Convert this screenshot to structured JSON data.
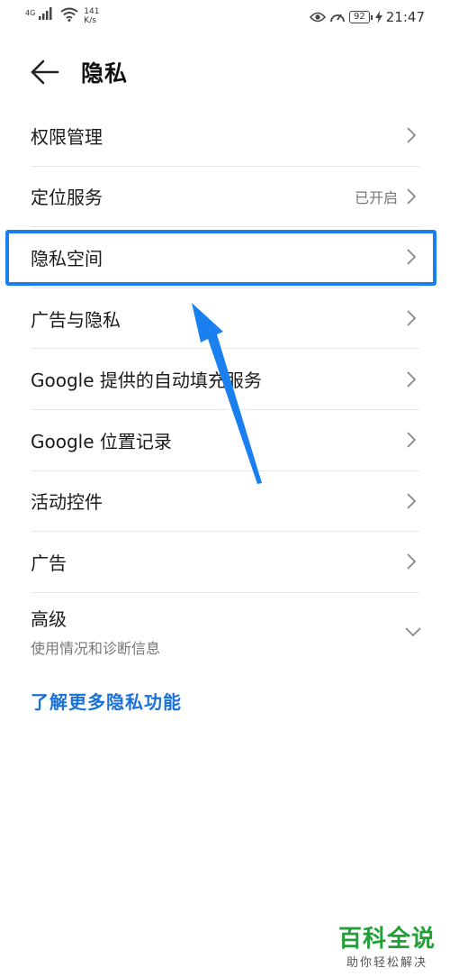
{
  "status_bar": {
    "signal_label": "4G",
    "speed_value": "141",
    "speed_unit": "K/s",
    "battery": "92",
    "time": "21:47"
  },
  "header": {
    "title": "隐私"
  },
  "list": {
    "items": [
      {
        "label": "权限管理",
        "value": ""
      },
      {
        "label": "定位服务",
        "value": "已开启"
      },
      {
        "label": "隐私空间",
        "value": ""
      },
      {
        "label": "广告与隐私",
        "value": ""
      },
      {
        "label": "Google 提供的自动填充服务",
        "value": ""
      },
      {
        "label": "Google 位置记录",
        "value": ""
      },
      {
        "label": "活动控件",
        "value": ""
      },
      {
        "label": "广告",
        "value": ""
      }
    ],
    "advanced": {
      "label": "高级",
      "subtitle": "使用情况和诊断信息"
    }
  },
  "learn_more": "了解更多隐私功能",
  "watermark": {
    "main": "百科全说",
    "sub": "助你轻松解决"
  },
  "colors": {
    "accent": "#1a80f0",
    "link": "#1a72d6",
    "watermark": "#22a038"
  }
}
